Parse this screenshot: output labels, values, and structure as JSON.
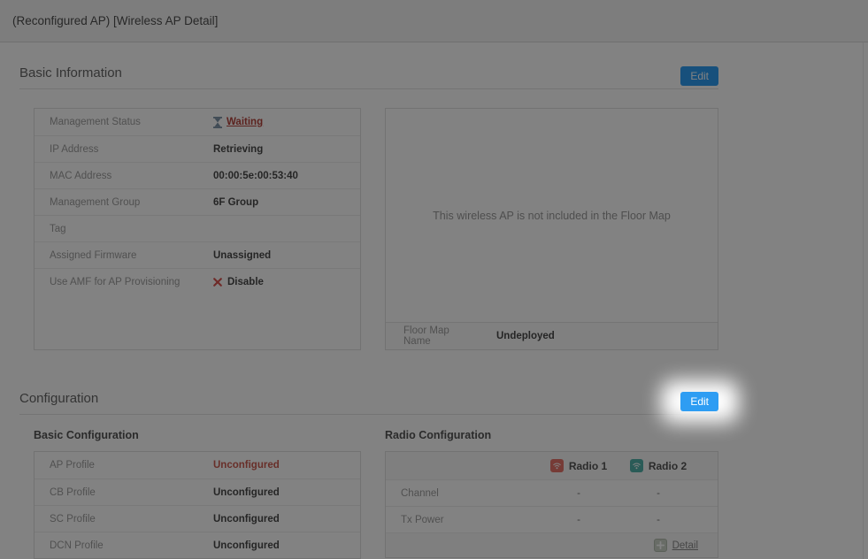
{
  "window": {
    "title": "(Reconfigured AP) [Wireless AP Detail]"
  },
  "basic_information": {
    "heading": "Basic Information",
    "edit_button": "Edit",
    "rows": [
      {
        "label": "Management Status",
        "value": "Waiting"
      },
      {
        "label": "IP Address",
        "value": "Retrieving"
      },
      {
        "label": "MAC Address",
        "value": "00:00:5e:00:53:40"
      },
      {
        "label": "Management Group",
        "value": "6F Group"
      },
      {
        "label": "Tag",
        "value": ""
      },
      {
        "label": "Assigned Firmware",
        "value": "Unassigned"
      },
      {
        "label": "Use AMF for AP Provisioning",
        "value": "Disable"
      }
    ],
    "floor_map": {
      "empty_message": "This wireless AP is not included in the Floor Map",
      "name_label": "Floor Map Name",
      "name_value": "Undeployed"
    }
  },
  "configuration": {
    "heading": "Configuration",
    "edit_button": "Edit",
    "basic_configuration": {
      "heading": "Basic Configuration",
      "rows": [
        {
          "label": "AP Profile",
          "value": "Unconfigured",
          "state": "error"
        },
        {
          "label": "CB Profile",
          "value": "Unconfigured",
          "state": "normal"
        },
        {
          "label": "SC Profile",
          "value": "Unconfigured",
          "state": "normal"
        },
        {
          "label": "DCN Profile",
          "value": "Unconfigured",
          "state": "normal"
        }
      ]
    },
    "radio_configuration": {
      "heading": "Radio Configuration",
      "columns": [
        {
          "label": "Radio 1"
        },
        {
          "label": "Radio 2"
        }
      ],
      "rows": [
        {
          "label": "Channel",
          "values": [
            "-",
            "-"
          ]
        },
        {
          "label": "Tx Power",
          "values": [
            "-",
            "-"
          ]
        }
      ],
      "detail_link": "Detail"
    }
  },
  "icons": {
    "management_status": "hourglass-icon",
    "amf_provisioning": "x-icon",
    "radio_1": "wifi-icon",
    "radio_2": "wifi-icon",
    "detail": "plus-icon"
  },
  "colors": {
    "accent_blue": "#2e9df3",
    "waiting_red": "#b5443c",
    "unconfigured_red": "#cd5c51",
    "radio1_icon": "#e8756a",
    "radio2_icon": "#53b3ab",
    "overlay": "rgba(0,0,0,0.49)"
  }
}
